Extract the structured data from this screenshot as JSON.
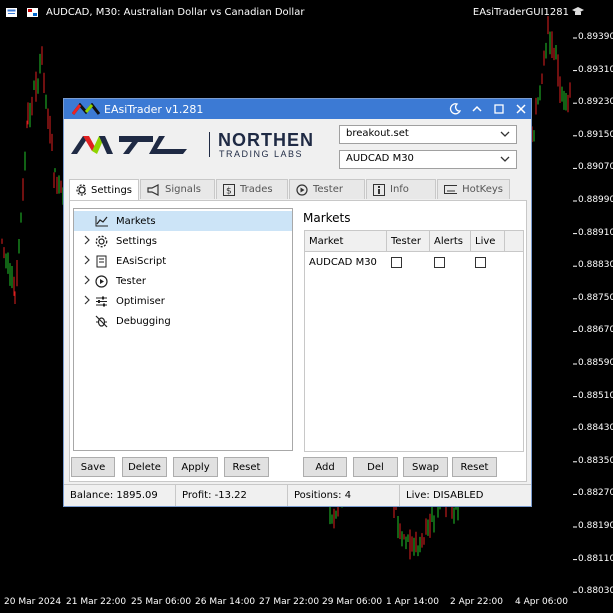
{
  "chart": {
    "symbol_line": "AUDCAD, M30:  Australian Dollar vs Canadian Dollar",
    "ea_name": "EAsiTraderGUI1281",
    "price_labels": [
      "0.89390",
      "0.89310",
      "0.89230",
      "0.89150",
      "0.89070",
      "0.88990",
      "0.88910",
      "0.88830",
      "0.88750",
      "0.88670",
      "0.88590",
      "0.88510",
      "0.88430",
      "0.88350",
      "0.88270",
      "0.88190",
      "0.88110",
      "0.88030"
    ],
    "date_labels": [
      "20 Mar 2024",
      "21 Mar 22:00",
      "25 Mar 06:00",
      "26 Mar 14:00",
      "27 Mar 22:00",
      "29 Mar 06:00",
      "1 Apr 14:00",
      "2 Apr 22:00",
      "4 Apr 06:00"
    ],
    "colors": {
      "up": "#22c42a",
      "down": "#e01f1f",
      "background": "#000000"
    }
  },
  "window": {
    "title": "EAsiTrader v1.281",
    "logo_main": "NORTHEN",
    "logo_sub": "TRADING LABS",
    "settings_file": "breakout.set",
    "symbol_select": "AUDCAD M30",
    "title_bar_color": "#3c7ad4"
  },
  "tabs": [
    {
      "label": "Settings",
      "icon": "gear-icon"
    },
    {
      "label": "Signals",
      "icon": "megaphone-icon"
    },
    {
      "label": "Trades",
      "icon": "dollar-icon"
    },
    {
      "label": "Tester",
      "icon": "play-icon"
    },
    {
      "label": "Info",
      "icon": "info-icon"
    },
    {
      "label": "HotKeys",
      "icon": "keyboard-icon"
    }
  ],
  "tree": [
    {
      "label": "Markets",
      "icon": "chart-line-icon",
      "expandable": false
    },
    {
      "label": "Settings",
      "icon": "gear-icon",
      "expandable": true
    },
    {
      "label": "EAsiScript",
      "icon": "script-icon",
      "expandable": true
    },
    {
      "label": "Tester",
      "icon": "play-circle-icon",
      "expandable": true
    },
    {
      "label": "Optimiser",
      "icon": "sliders-icon",
      "expandable": true
    },
    {
      "label": "Debugging",
      "icon": "bug-icon",
      "expandable": false
    }
  ],
  "markets_panel": {
    "title": "Markets",
    "columns": [
      "Market",
      "Tester",
      "Alerts",
      "Live"
    ],
    "rows": [
      {
        "market": "AUDCAD M30"
      }
    ]
  },
  "left_buttons": [
    "Save",
    "Delete",
    "Apply",
    "Reset"
  ],
  "right_buttons": [
    "Add",
    "Del",
    "Swap",
    "Reset"
  ],
  "status": {
    "balance": "Balance: 1895.09",
    "profit": "Profit: -13.22",
    "positions": "Positions: 4",
    "live": "Live: DISABLED"
  }
}
